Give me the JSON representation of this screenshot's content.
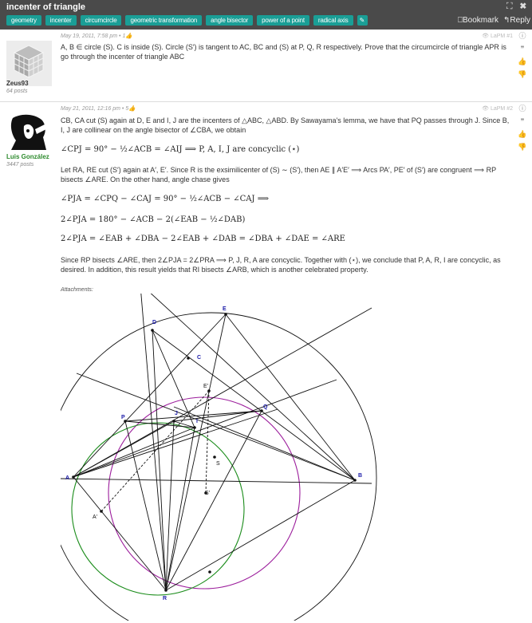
{
  "topic": {
    "title": "incenter of triangle",
    "window_icons": "⛶ ✖",
    "tags": [
      "geometry",
      "incenter",
      "circumcircle",
      "geometric transformation",
      "angle bisector",
      "power of a point",
      "radical axis"
    ],
    "bookmark_label": "Bookmark",
    "reply_label": "Reply"
  },
  "post1": {
    "date": "May 19, 2011, 7:58 pm",
    "likes": "1",
    "post_num": "#1",
    "time_right": "LaPM",
    "username": "Zeus93",
    "post_count": "64 posts",
    "text": "A, B ∈ circle (S). C is inside (S). Circle (S′) is tangent to AC, BC and (S) at P, Q, R respectively. Prove that the circumcircle of triangle APR is go through the incenter of triangle ABC"
  },
  "post2": {
    "date": "May 21, 2011, 12:16 pm",
    "likes": "5",
    "post_num": "#2",
    "time_right": "LaPM",
    "username": "Luis González",
    "post_count": "3447 posts",
    "p1": "CB, CA cut (S) again at D, E and I, J are the incenters of △ABC, △ABD. By Sawayama's lemma, we have that PQ passes through J. Since B, I, J are collinear on the angle bisector of ∠CBA, we obtain",
    "eq1": "∠CPJ = 90° − ½∠ACB = ∠AIJ ⟹ P, A, I, J are concyclic (⋆)",
    "p2": "Let RA, RE cut (S′) again at A′, E′. Since R is the exsimilicenter of (S) ∼ (S′), then AE ∥ A′E′ ⟹ Arcs PA′, PE′ of (S′) are congruent ⟹ RP bisects ∠ARE. On the other hand, angle chase gives",
    "eq2": "∠PJA = ∠CPQ − ∠CAJ = 90° − ½∠ACB − ∠CAJ ⟹",
    "eq3": "2∠PJA = 180° − ∠ACB − 2(∠EAB − ½∠DAB)",
    "eq4": "2∠PJA = ∠EAB + ∠DBA − 2∠EAB + ∠DAB = ∠DBA + ∠DAE = ∠ARE",
    "p3": "Since RP bisects ∠ARE, then 2∠PJA = 2∠PRA ⟹ P, J, R, A are concyclic. Together with (⋆), we conclude that P, A, R, I are concyclic, as desired. In addition, this result yields that RI bisects ∠ARB, which is another celebrated property.",
    "attachments": "Attachments:"
  },
  "figure_labels": {
    "A": "A",
    "B": "B",
    "C": "C",
    "D": "D",
    "E": "E",
    "E2": "E'",
    "P": "P",
    "Q": "Q",
    "J": "J",
    "I": "I",
    "S": "S",
    "S2": "S'",
    "A2": "A'",
    "R": "R"
  },
  "colors": {
    "title_bar": "#4a4a4a",
    "tag": "#1a9e96",
    "circle_S": "#111111",
    "circle_purple": "#9b1c9b",
    "circle_green": "#1a8c1a",
    "label_blue": "#1a1aa8"
  },
  "icon_names": [
    "expand-icon",
    "close-icon",
    "edit-icon",
    "bookmark-icon",
    "reply-icon",
    "eye-icon",
    "info-icon",
    "quote-icon",
    "like-icon",
    "dislike-icon"
  ]
}
